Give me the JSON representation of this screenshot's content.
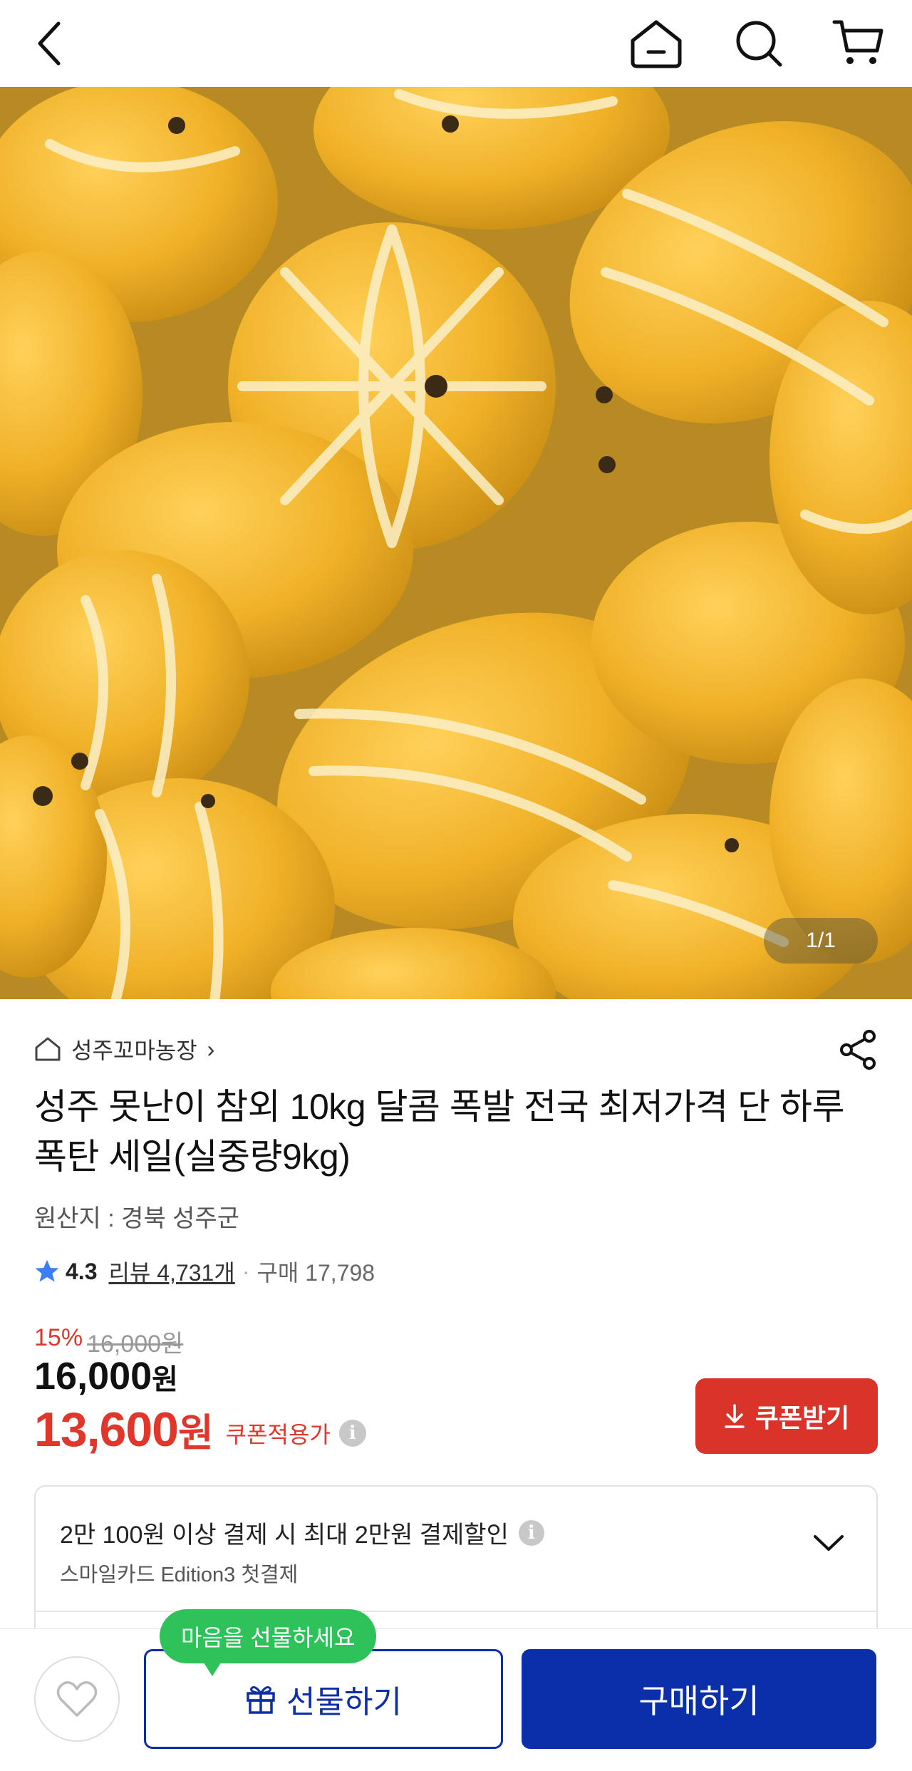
{
  "nav": {
    "back_icon": "chevron-left-icon",
    "home_icon": "home-icon",
    "search_icon": "search-icon",
    "cart_icon": "cart-icon"
  },
  "hero": {
    "counter": "1/1"
  },
  "seller": {
    "name": "성주꼬마농장",
    "chevron": "›",
    "store_icon": "store-icon",
    "share_icon": "share-icon"
  },
  "product": {
    "title": "성주 못난이 참외  10kg 달콤 폭발 전국 최저가격 단 하루 폭탄 세일(실중량9kg)",
    "origin": "원산지 : 경북 성주군",
    "rating": "4.3",
    "reviews": "리뷰 4,731개",
    "separator": "·",
    "purchases": "구매 17,798"
  },
  "price": {
    "discount_pct": "15%",
    "original": "16,000원",
    "price_number": "16,000",
    "price_unit": "원",
    "coupon_price_number": "13,600",
    "coupon_price_unit": "원",
    "coupon_label": "쿠폰적용가",
    "info": "i",
    "coupon_button": "쿠폰받기"
  },
  "benefit": {
    "title": "2만 100원 이상 결제 시 최대 2만원 결제할인",
    "subtitle": "스마일카드 Edition3 첫결제",
    "info": "i"
  },
  "bottom": {
    "tooltip": "마음을 선물하세요",
    "gift_button": "선물하기",
    "buy_button": "구매하기"
  },
  "colors": {
    "accent_red": "#e0362c",
    "primary_blue": "#0b2ea9",
    "tooltip_green": "#2fc15a"
  }
}
